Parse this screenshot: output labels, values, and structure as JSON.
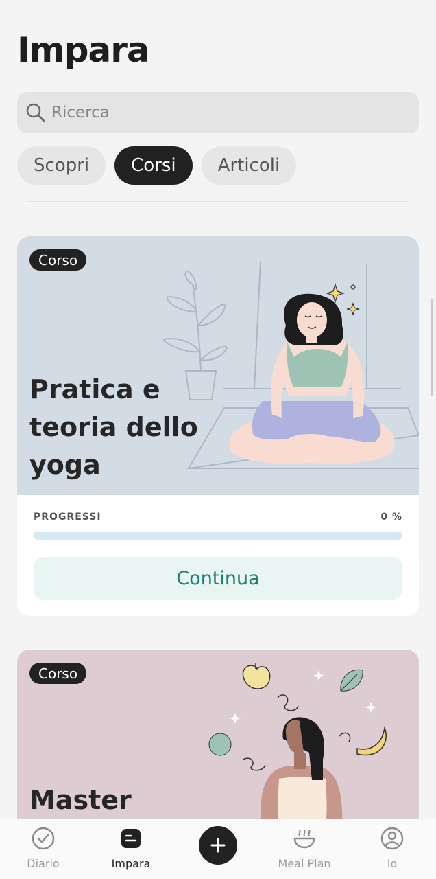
{
  "header": {
    "title": "Impara"
  },
  "search": {
    "placeholder": "Ricerca",
    "icon": "search-icon"
  },
  "tabs": [
    {
      "label": "Scopri",
      "active": false
    },
    {
      "label": "Corsi",
      "active": true
    },
    {
      "label": "Articoli",
      "active": false
    }
  ],
  "courses": [
    {
      "badge": "Corso",
      "title": "Pratica e teoria dello yoga",
      "progress_label": "PROGRESSI",
      "progress_value": "0 %",
      "progress_fraction": 0,
      "button_label": "Continua",
      "hero_color": "#d3dbe5"
    },
    {
      "badge": "Corso",
      "title": "Master",
      "hero_color": "#ddcdd2"
    }
  ],
  "bottom_nav": {
    "items": [
      {
        "label": "Diario",
        "icon": "check-circle-icon",
        "active": false
      },
      {
        "label": "Impara",
        "icon": "learn-icon",
        "active": true
      },
      {
        "label": "",
        "icon": "plus-icon",
        "active": false
      },
      {
        "label": "Meal Plan",
        "icon": "bowl-icon",
        "active": false
      },
      {
        "label": "Io",
        "icon": "profile-icon",
        "active": false
      }
    ]
  },
  "colors": {
    "accent": "#1f7d72",
    "dark": "#222222",
    "background": "#f4f4f4"
  }
}
